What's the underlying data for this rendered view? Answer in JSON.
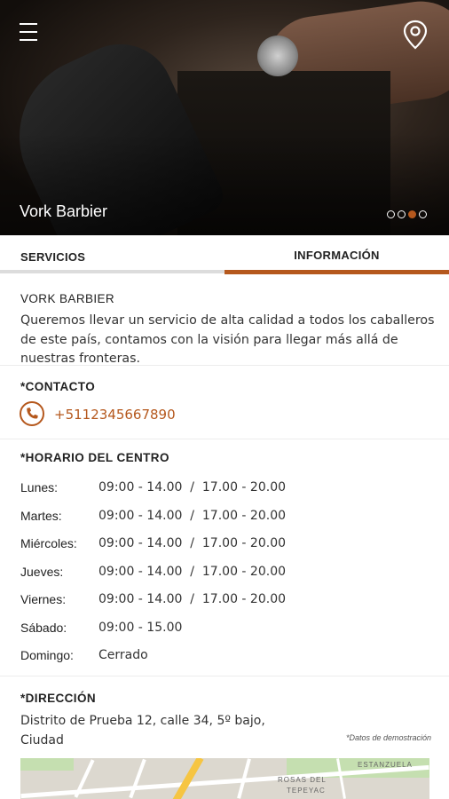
{
  "hero": {
    "title": "Vork Barbier",
    "slides": 4,
    "active_slide": 3,
    "menu_icon": "hamburger-menu-icon",
    "location_icon": "location-pin-icon"
  },
  "tabs": [
    {
      "label": "SERVICIOS",
      "active": false
    },
    {
      "label": "INFORMACIÓN",
      "active": true
    }
  ],
  "about": {
    "title": "VORK BARBIER",
    "text": "Queremos llevar un servicio de alta calidad a todos los caballeros de este país, contamos con la visión para llegar más allá de nuestras fronteras."
  },
  "contact": {
    "title": "*CONTACTO",
    "phone_icon": "phone-icon",
    "phone": "+5112345667890"
  },
  "hours": {
    "title": "*HORARIO DEL CENTRO",
    "rows": [
      {
        "day": "Lunes:",
        "time": "09:00 - 14.00  /  17.00 - 20.00"
      },
      {
        "day": "Martes:",
        "time": "09:00 - 14.00  /  17.00 - 20.00"
      },
      {
        "day": "Miércoles:",
        "time": "09:00 - 14.00  /  17.00 - 20.00"
      },
      {
        "day": "Jueves:",
        "time": "09:00 - 14.00  /  17.00 - 20.00"
      },
      {
        "day": "Viernes:",
        "time": "09:00 - 14.00  /  17.00 - 20.00"
      },
      {
        "day": "Sábado:",
        "time": "09:00 - 15.00"
      },
      {
        "day": "Domingo:",
        "time": "Cerrado"
      }
    ]
  },
  "address": {
    "title": "*DIRECCIÓN",
    "line1": "Distrito de Prueba 12, calle 34, 5º bajo,",
    "line2": "Ciudad",
    "demo_note": "*Datos de demostración"
  },
  "map": {
    "labels": [
      "ESTANZUELA",
      "ROSAS DEL",
      "TEPEYAC"
    ]
  },
  "colors": {
    "accent": "#b5581d",
    "tab_inactive_bar": "#dcdcdc"
  }
}
